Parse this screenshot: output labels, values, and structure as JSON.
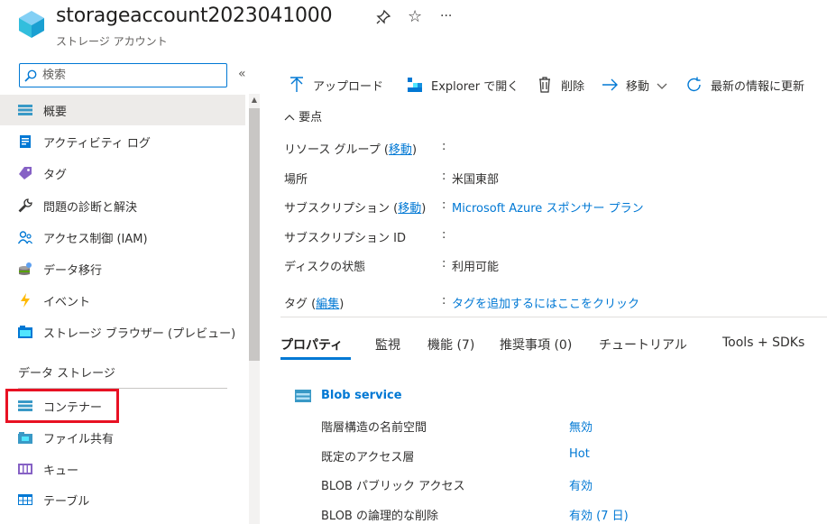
{
  "header": {
    "title": "storageaccount2023041000",
    "subtitle": "ストレージ アカウント",
    "actions": {
      "pin": "pin-icon",
      "favorite": "☆",
      "more": "···"
    }
  },
  "sidebar": {
    "search_placeholder": "検索",
    "collapse": "«",
    "items": [
      {
        "label": "概要",
        "icon": "overview-icon"
      },
      {
        "label": "アクティビティ ログ",
        "icon": "activity-log-icon"
      },
      {
        "label": "タグ",
        "icon": "tag-icon"
      },
      {
        "label": "問題の診断と解決",
        "icon": "wrench-icon"
      },
      {
        "label": "アクセス制御 (IAM)",
        "icon": "iam-icon"
      },
      {
        "label": "データ移行",
        "icon": "data-migration-icon"
      },
      {
        "label": "イベント",
        "icon": "lightning-icon"
      },
      {
        "label": "ストレージ ブラウザー (プレビュー)",
        "icon": "storage-browser-icon"
      }
    ],
    "section_label": "データ ストレージ",
    "storage_items": [
      {
        "label": "コンテナー",
        "icon": "container-icon"
      },
      {
        "label": "ファイル共有",
        "icon": "file-share-icon"
      },
      {
        "label": "キュー",
        "icon": "queue-icon"
      },
      {
        "label": "テーブル",
        "icon": "table-icon"
      }
    ]
  },
  "toolbar": {
    "upload": "アップロード",
    "explorer": "Explorer で開く",
    "delete": "削除",
    "move": "移動",
    "refresh": "最新の情報に更新"
  },
  "essentials": {
    "toggle": "要点",
    "rows": [
      {
        "key": "リソース グループ",
        "link": "移動",
        "value": ""
      },
      {
        "key": "場所",
        "link": "",
        "value": "米国東部"
      },
      {
        "key": "サブスクリプション",
        "link": "移動",
        "value": "Microsoft Azure スポンサー プラン"
      },
      {
        "key": "サブスクリプション ID",
        "link": "",
        "value": ""
      },
      {
        "key": "ディスクの状態",
        "link": "",
        "value": "利用可能"
      },
      {
        "key": "タグ",
        "link": "編集",
        "value": "タグを追加するにはここをクリック"
      }
    ]
  },
  "tabs": [
    {
      "label": "プロパティ",
      "active": true
    },
    {
      "label": "監視",
      "active": false
    },
    {
      "label": "機能 (7)",
      "active": false
    },
    {
      "label": "推奨事項 (0)",
      "active": false
    },
    {
      "label": "チュートリアル",
      "active": false
    },
    {
      "label": "Tools + SDKs",
      "active": false
    }
  ],
  "properties": {
    "section_title": "Blob service",
    "rows": [
      {
        "key": "階層構造の名前空間",
        "value": "無効"
      },
      {
        "key": "既定のアクセス層",
        "value": "Hot"
      },
      {
        "key": "BLOB パブリック アクセス",
        "value": "有効"
      },
      {
        "key": "BLOB の論理的な削除",
        "value": "有効 (7 日)"
      }
    ]
  },
  "colors": {
    "accent": "#0078d4",
    "highlight_box": "#e81123",
    "selected_bg": "#edebe9"
  }
}
